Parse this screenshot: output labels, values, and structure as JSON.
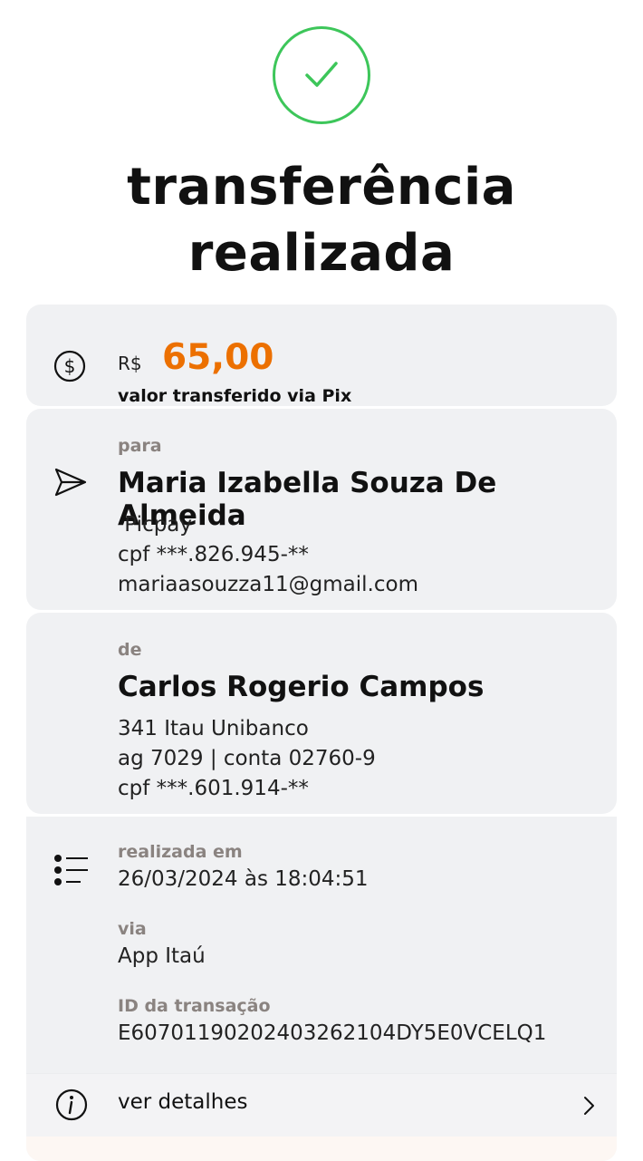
{
  "header": {
    "status_icon": "check-circle-icon",
    "title_line1": "transferência",
    "title_line2": "realizada",
    "accent_color": "#3dc65a"
  },
  "amount": {
    "icon": "dollar-circle-icon",
    "currency": "R$",
    "value": "65,00",
    "caption": "valor transferido via Pix",
    "value_color": "#ec7000"
  },
  "recipient": {
    "icon": "send-icon",
    "label": "para",
    "name": "Maria Izabella Souza De Almeida",
    "bank": " Picpay",
    "cpf": "cpf ***.826.945-**",
    "email": "mariaasouzza11@gmail.com"
  },
  "sender": {
    "label": "de",
    "name": "Carlos Rogerio Campos",
    "bank": "341 Itau Unibanco",
    "account": "ag 7029 | conta 02760-9",
    "cpf": "cpf ***.601.914-**"
  },
  "details": {
    "icon": "list-icon",
    "date_label": "realizada em",
    "date_value": "26/03/2024 às 18:04:51",
    "via_label": "via",
    "via_value": "App Itaú",
    "id_label": "ID da transação",
    "id_value": "E60701190202403262104DY5E0VCELQ1"
  },
  "footer": {
    "icon": "info-icon",
    "link_label": "ver detalhes",
    "chevron_icon": "chevron-right-icon"
  }
}
